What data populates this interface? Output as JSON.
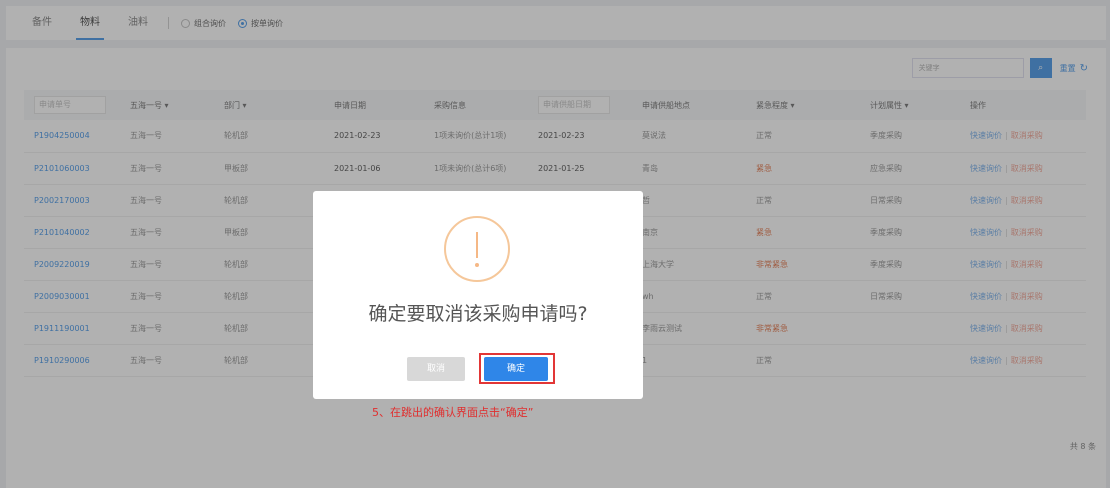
{
  "tabs": [
    {
      "label": "备件"
    },
    {
      "label": "物料"
    },
    {
      "label": "油料"
    }
  ],
  "pricing_options": [
    {
      "label": "组合询价",
      "selected": false
    },
    {
      "label": "按单询价",
      "selected": true
    }
  ],
  "toolbar": {
    "search_placeholder": "关键字",
    "reset_label": "重置",
    "refresh_icon": "↻",
    "search_icon": "⌕"
  },
  "table": {
    "headers": {
      "no": "申请单号",
      "ship": "五海一号 ▾",
      "dept": "部门 ▾",
      "apply_date": "申请日期",
      "purchase_info": "采购信息",
      "supply_date": "申请供船日期",
      "supply_place": "申请供船地点",
      "urgency": "紧急程度 ▾",
      "plan_type": "计划属性 ▾",
      "ops": "操作"
    },
    "rows": [
      {
        "no": "P1904250004",
        "ship": "五海一号",
        "dept": "轮机部",
        "apply_date": "2021-02-23",
        "purchase_info": "1项未询价(总计1项)",
        "supply_date": "2021-02-23",
        "supply_place": "莫说法",
        "urgency": "正常",
        "plan_type": "季度采购",
        "op1": "快速询价",
        "op2": "取消采购"
      },
      {
        "no": "P2101060003",
        "ship": "五海一号",
        "dept": "甲板部",
        "apply_date": "2021-01-06",
        "purchase_info": "1项未询价(总计6项)",
        "supply_date": "2021-01-25",
        "supply_place": "青岛",
        "urgency": "紧急",
        "plan_type": "应急采购",
        "op1": "快速询价",
        "op2": "取消采购"
      },
      {
        "no": "P2002170003",
        "ship": "五海一号",
        "dept": "轮机部",
        "apply_date": "",
        "purchase_info": "",
        "supply_date": "",
        "supply_place": "哲",
        "urgency": "正常",
        "plan_type": "日常采购",
        "op1": "快速询价",
        "op2": "取消采购"
      },
      {
        "no": "P2101040002",
        "ship": "五海一号",
        "dept": "甲板部",
        "apply_date": "",
        "purchase_info": "",
        "supply_date": "",
        "supply_place": "南京",
        "urgency": "紧急",
        "plan_type": "季度采购",
        "op1": "快速询价",
        "op2": "取消采购"
      },
      {
        "no": "P2009220019",
        "ship": "五海一号",
        "dept": "轮机部",
        "apply_date": "",
        "purchase_info": "",
        "supply_date": "",
        "supply_place": "上海大学",
        "urgency": "非常紧急",
        "plan_type": "季度采购",
        "op1": "快速询价",
        "op2": "取消采购"
      },
      {
        "no": "P2009030001",
        "ship": "五海一号",
        "dept": "轮机部",
        "apply_date": "",
        "purchase_info": "",
        "supply_date": "",
        "supply_place": "wh",
        "urgency": "正常",
        "plan_type": "日常采购",
        "op1": "快速询价",
        "op2": "取消采购"
      },
      {
        "no": "P1911190001",
        "ship": "五海一号",
        "dept": "轮机部",
        "apply_date": "",
        "purchase_info": "",
        "supply_date": "",
        "supply_place": "李雨云测试",
        "urgency": "非常紧急",
        "plan_type": "",
        "op1": "快速询价",
        "op2": "取消采购"
      },
      {
        "no": "P1910290006",
        "ship": "五海一号",
        "dept": "轮机部",
        "apply_date": "",
        "purchase_info": "",
        "supply_date": "",
        "supply_place": "1",
        "urgency": "正常",
        "plan_type": "",
        "op1": "快速询价",
        "op2": "取消采购"
      }
    ],
    "total": "共 8 条"
  },
  "modal": {
    "message": "确定要取消该采购申请吗?",
    "cancel_label": "取消",
    "confirm_label": "确定",
    "icon": "warning-circle"
  },
  "annotation": "5、在跳出的确认界面点击“确定”",
  "colors": {
    "accent": "#3b8fe6",
    "urgent": "#e06a3b",
    "highlight": "#e23636"
  }
}
